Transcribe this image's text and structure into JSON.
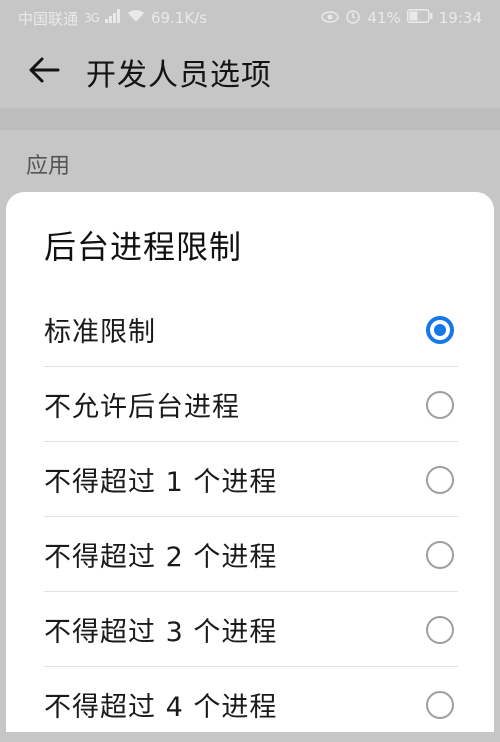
{
  "status_bar": {
    "carrier": "中国联通",
    "network": "3G",
    "speed": "69.1K/s",
    "battery": "41%",
    "time": "19:34",
    "icons": [
      "signal-icon",
      "wifi-icon",
      "eye-icon",
      "alarm-icon",
      "battery-icon"
    ]
  },
  "header": {
    "title": "开发人员选项",
    "back_icon": "back-arrow-icon"
  },
  "section": {
    "label": "应用"
  },
  "dialog": {
    "title": "后台进程限制",
    "options": [
      {
        "label": "标准限制",
        "selected": true
      },
      {
        "label": "不允许后台进程",
        "selected": false
      },
      {
        "label": "不得超过 1 个进程",
        "selected": false
      },
      {
        "label": "不得超过 2 个进程",
        "selected": false
      },
      {
        "label": "不得超过 3 个进程",
        "selected": false
      },
      {
        "label": "不得超过 4 个进程",
        "selected": false
      }
    ]
  },
  "colors": {
    "accent": "#1677e8",
    "scrim": "#c6c6c6",
    "dialog_bg": "#ffffff"
  }
}
